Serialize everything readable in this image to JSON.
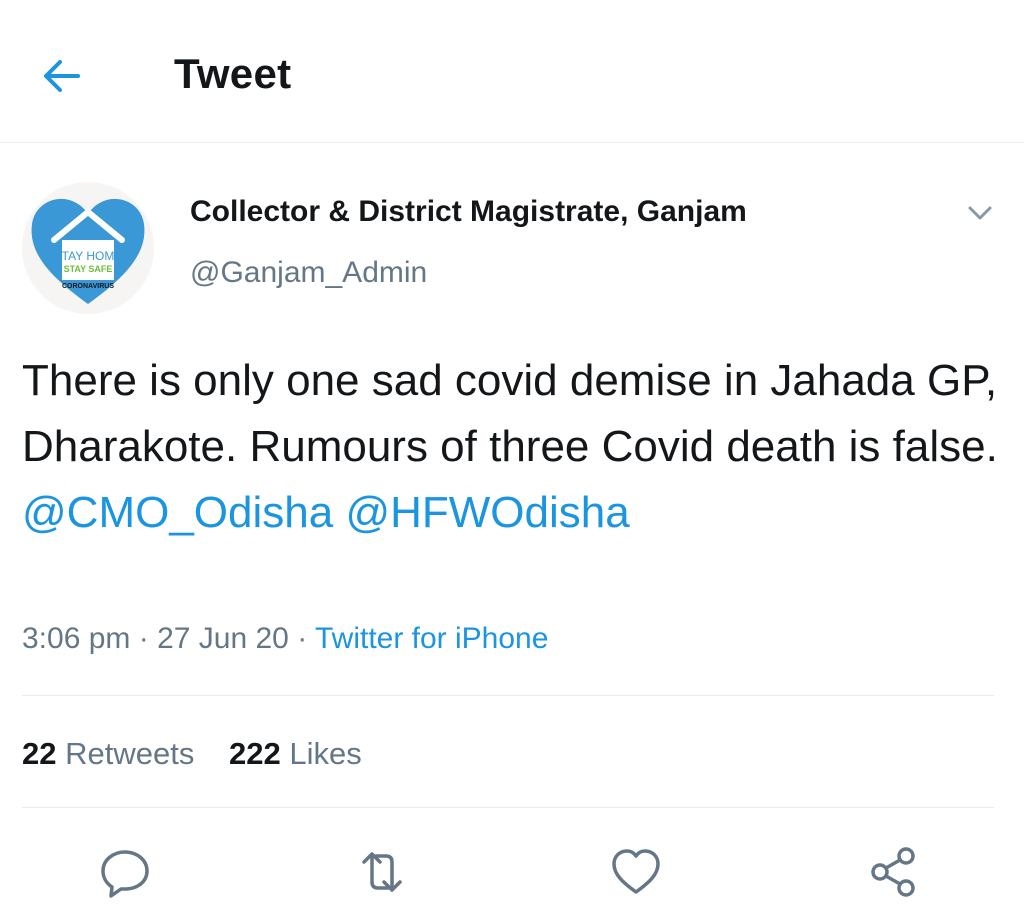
{
  "header": {
    "title": "Tweet"
  },
  "author": {
    "display_name": "Collector & District Magistrate, Ganjam",
    "handle": "@Ganjam_Admin",
    "avatar": {
      "line1": "STAY HOME",
      "line2": "STAY SAFE",
      "line3": "CORONAVIRUS"
    }
  },
  "tweet": {
    "text": "There is only one sad covid demise in Jahada GP, Dharakote. Rumours of three Covid death is false.",
    "mention1": "@CMO_Odisha",
    "mention2": "@HFWOdisha",
    "time": "3:06 pm",
    "sep1": " · ",
    "date": "27 Jun 20",
    "sep2": " · ",
    "source": "Twitter for iPhone"
  },
  "stats": {
    "retweets_count": "22",
    "retweets_label": "Retweets",
    "likes_count": "222",
    "likes_label": "Likes"
  },
  "colors": {
    "accent": "#1b95e0",
    "secondary_text": "#657786",
    "primary_text": "#14171a",
    "divider": "#e6ecf0"
  },
  "icons": [
    "back-arrow-icon",
    "chevron-down-icon",
    "reply-icon",
    "retweet-icon",
    "like-icon",
    "share-icon"
  ]
}
